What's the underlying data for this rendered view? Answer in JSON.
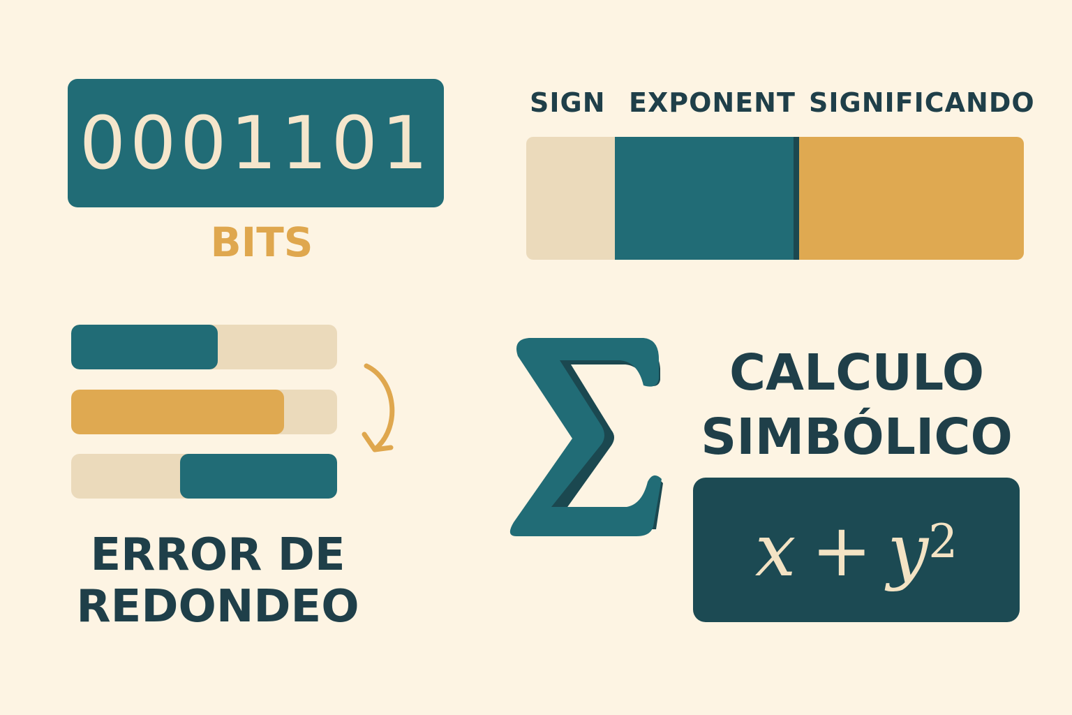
{
  "bits": {
    "value": "0001101",
    "label": "BITS"
  },
  "float_format": {
    "labels": [
      "SIGN",
      "EXPONENT",
      "SIGNIFICANDO"
    ]
  },
  "rounding": {
    "label_line1": "ERROR DE",
    "label_line2": "REDONDEO",
    "bars": [
      {
        "color": "#216C76",
        "start": 0.0,
        "end": 0.55
      },
      {
        "color": "#DFA951",
        "start": 0.0,
        "end": 0.8
      },
      {
        "color": "#216C76",
        "start": 0.41,
        "end": 1.0
      }
    ]
  },
  "symbolic": {
    "title_line1": "CALCULO",
    "title_line2": "SIMBÓLICO",
    "formula": {
      "var1": "x",
      "op": "+",
      "var2": "y",
      "exp": "2"
    }
  },
  "colors": {
    "background": "#FDF4E3",
    "teal": "#216C76",
    "dark_teal": "#1C4A53",
    "gold": "#DFA951",
    "beige": "#EBDABB",
    "navy_text": "#1F3F49"
  },
  "icons": [
    "sigma-icon",
    "curved-arrow-icon"
  ]
}
